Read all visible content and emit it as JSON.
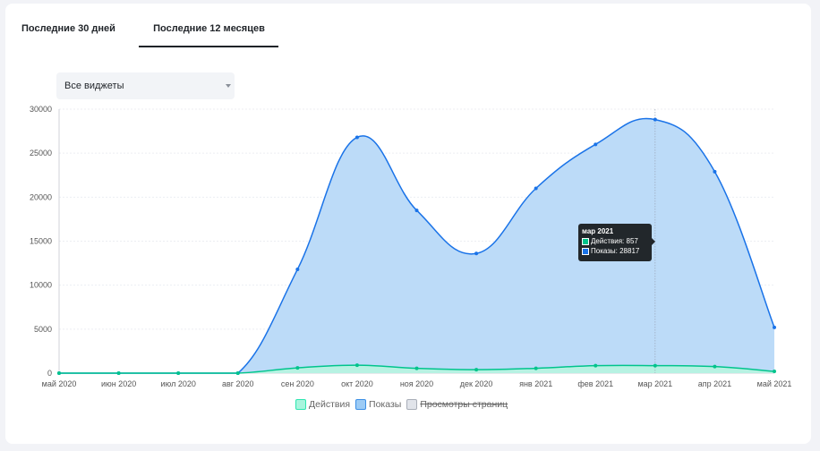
{
  "tabs": [
    {
      "label": "Последние 30 дней",
      "active": false
    },
    {
      "label": "Последние 12 месяцев",
      "active": true
    }
  ],
  "filter": {
    "selected": "Все виджеты"
  },
  "tooltip": {
    "title": "мар 2021",
    "rows": [
      {
        "label": "Действия: 857",
        "color": "#00c48c"
      },
      {
        "label": "Показы: 28817",
        "color": "#1a73e8"
      }
    ]
  },
  "legend": [
    {
      "label": "Действия",
      "fill": "#a8f5dd",
      "border": "#2ee6b0",
      "enabled": true
    },
    {
      "label": "Показы",
      "fill": "#9ccbf5",
      "border": "#3b8fe6",
      "enabled": true
    },
    {
      "label": "Просмотры страниц",
      "fill": "#e1e4ea",
      "border": "#a9aeb8",
      "enabled": false
    }
  ],
  "chart_data": {
    "type": "area",
    "categories": [
      "май 2020",
      "июн 2020",
      "июл 2020",
      "авг 2020",
      "сен 2020",
      "окт 2020",
      "ноя 2020",
      "дек 2020",
      "янв 2021",
      "фев 2021",
      "мар 2021",
      "апр 2021",
      "май 2021"
    ],
    "series": [
      {
        "name": "Показы",
        "color": "#1a73e8",
        "fill": "#b8d9f8",
        "values": [
          0,
          0,
          0,
          0,
          11800,
          26800,
          18500,
          13600,
          21000,
          26000,
          28817,
          22900,
          5200
        ]
      },
      {
        "name": "Действия",
        "color": "#00c48c",
        "fill": "#b6f3e0",
        "values": [
          0,
          0,
          0,
          0,
          600,
          900,
          550,
          400,
          550,
          850,
          857,
          750,
          200
        ]
      }
    ],
    "ylim": [
      0,
      30000
    ],
    "yticks": [
      0,
      5000,
      10000,
      15000,
      20000,
      25000,
      30000
    ],
    "grid": true,
    "hover_category": "мар 2021",
    "legend_position": "bottom"
  }
}
